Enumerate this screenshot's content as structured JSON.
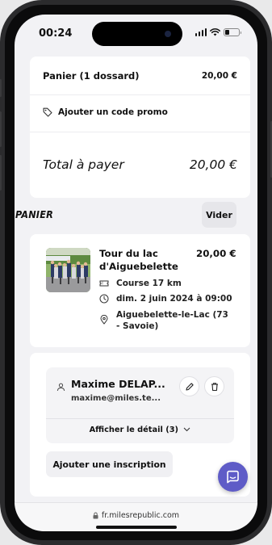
{
  "status_bar": {
    "time": "00:24"
  },
  "summary": {
    "cart_label": "Panier (1 dossard)",
    "cart_amount": "20,00 €",
    "promo_label": "Ajouter un code promo",
    "total_label": "Total à payer",
    "total_amount": "20,00 €"
  },
  "panier": {
    "title": "PANIER",
    "clear_button": "Vider"
  },
  "event": {
    "title": "Tour du lac d'Aiguebelette",
    "price": "20,00 €",
    "course": "Course 17 km",
    "date": "dim. 2 juin 2024 à 09:00",
    "location": "Aiguebelette-le-Lac (73 - Savoie)"
  },
  "registration": {
    "name": "Maxime DELAP...",
    "email": "maxime@miles.te...",
    "detail_toggle": "Afficher le détail (3)",
    "add_button": "Ajouter une inscription"
  },
  "browser": {
    "url": "fr.milesrepublic.com"
  },
  "colors": {
    "accent": "#5f5cc7",
    "card": "#ffffff",
    "background": "#f2f2f5"
  }
}
